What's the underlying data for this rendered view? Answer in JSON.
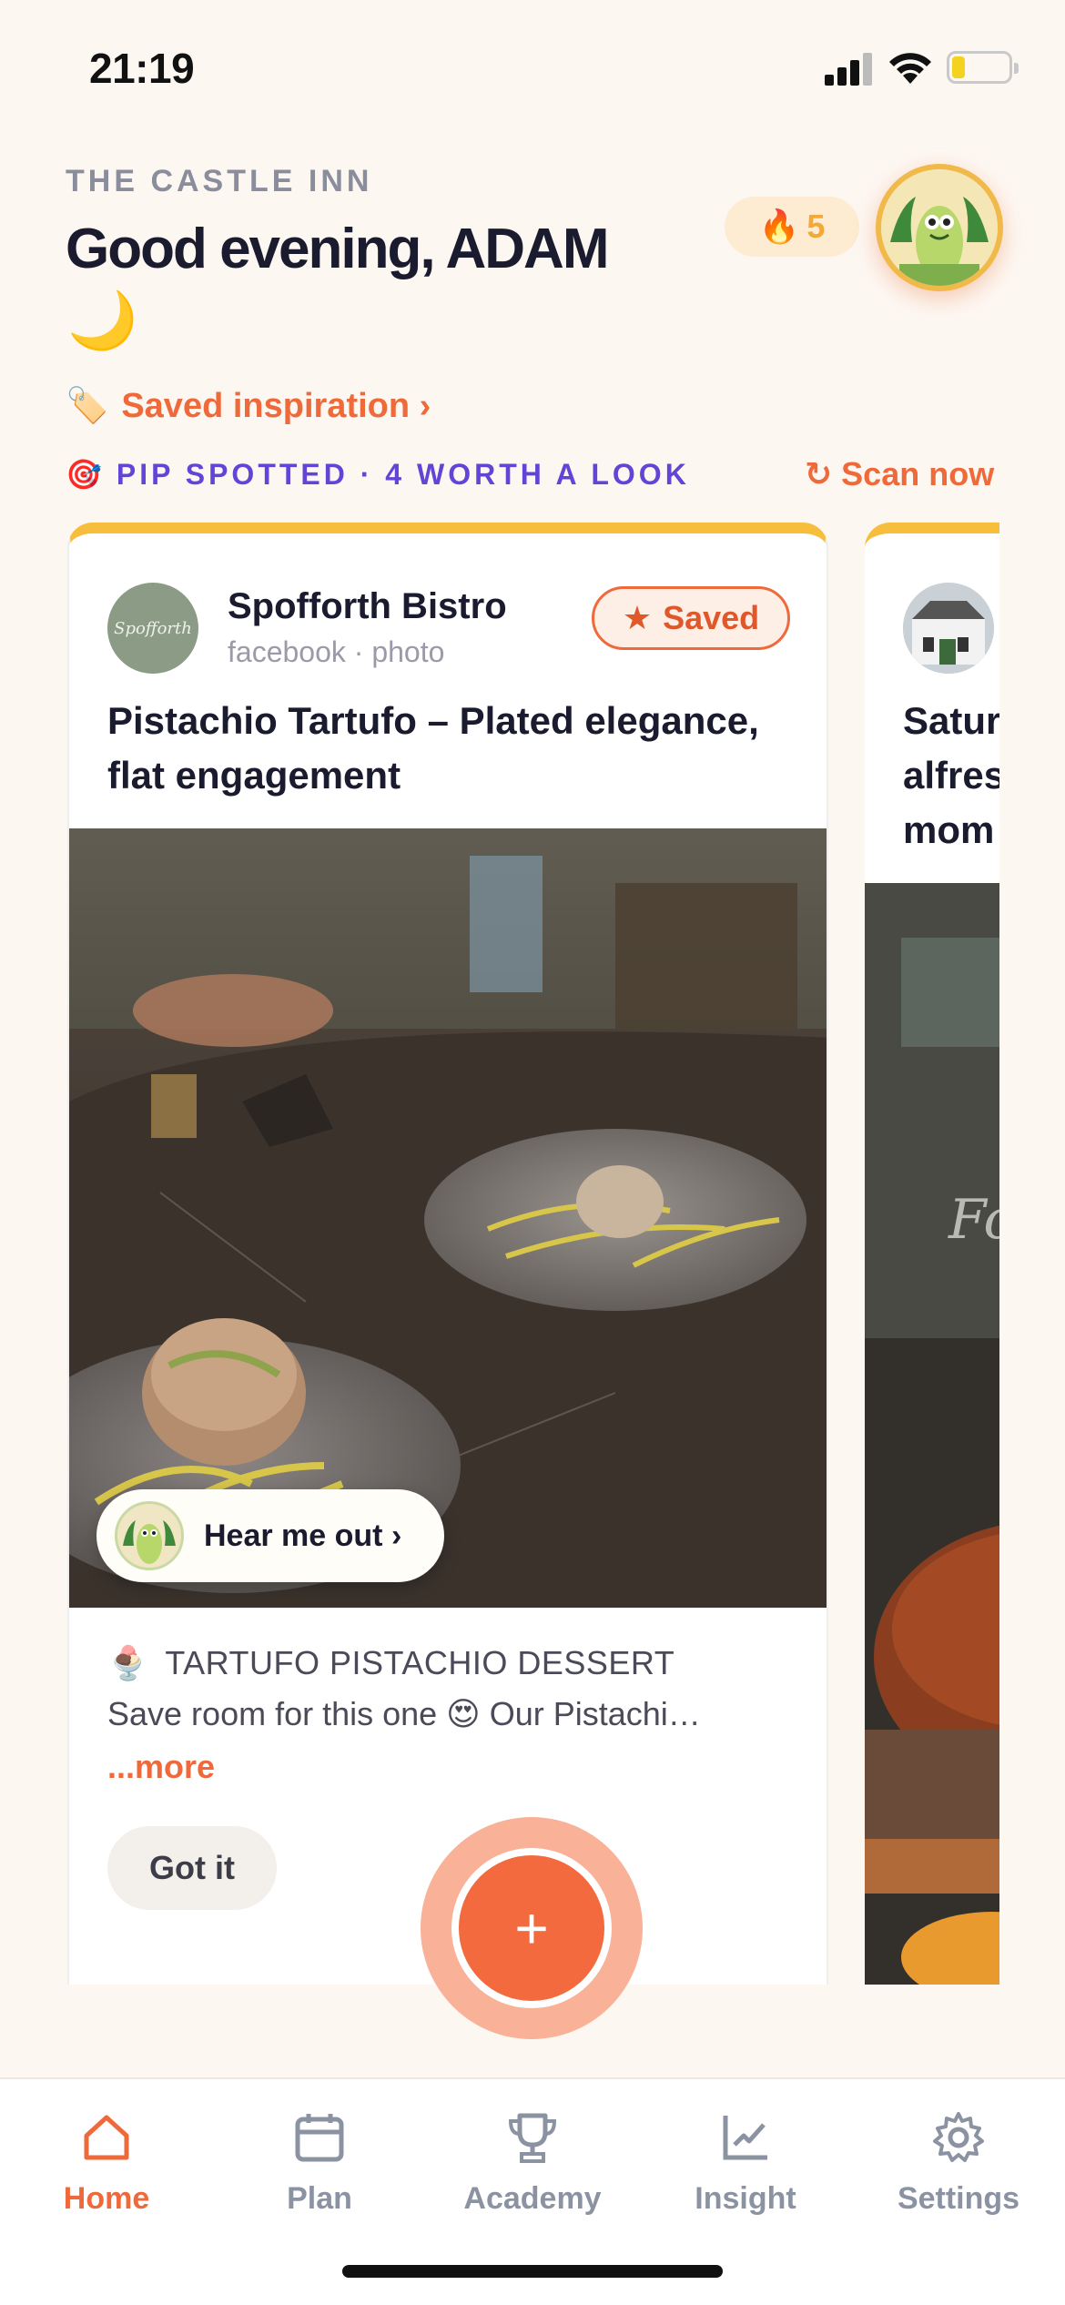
{
  "status": {
    "time": "21:19"
  },
  "header": {
    "venue": "THE CASTLE INN",
    "greeting": "Good evening, ADAM",
    "moon": "🌙",
    "streak_icon": "🔥",
    "streak_count": "5"
  },
  "links": {
    "saved_inspiration": "Saved inspiration ›",
    "saved_icon": "🏷️",
    "spotted_icon": "🎯",
    "spotted": "PIP SPOTTED · 4 WORTH A LOOK",
    "scan_icon": "↻",
    "scan_now": "Scan now"
  },
  "card": {
    "venue": "Spofforth Bistro",
    "logo_text": "Spofforth",
    "source": "facebook · photo",
    "saved_icon": "★",
    "saved_label": "Saved",
    "title": "Pistachio Tartufo – Plated elegance, flat engagement",
    "hear_me_out": "Hear me out ›",
    "desc_icon": "🍨",
    "desc_heading": "TARTUFO PISTACHIO DESSERT",
    "desc_body": "Save room for this one 😍 Our Pistachi…",
    "more": "...more",
    "got_it": "Got it"
  },
  "card2": {
    "title": "Satur\nalfres\nmom"
  },
  "fab": {
    "label": "+"
  },
  "tabs": [
    {
      "label": "Home",
      "icon": "home-icon",
      "active": true
    },
    {
      "label": "Plan",
      "icon": "calendar-icon",
      "active": false
    },
    {
      "label": "Academy",
      "icon": "trophy-icon",
      "active": false
    },
    {
      "label": "Insight",
      "icon": "chart-icon",
      "active": false
    },
    {
      "label": "Settings",
      "icon": "gear-icon",
      "active": false
    }
  ],
  "colors": {
    "accent": "#ef6a3a",
    "purple": "#6045d6",
    "card_border": "#f7be3e",
    "background": "#fdf7f2"
  }
}
